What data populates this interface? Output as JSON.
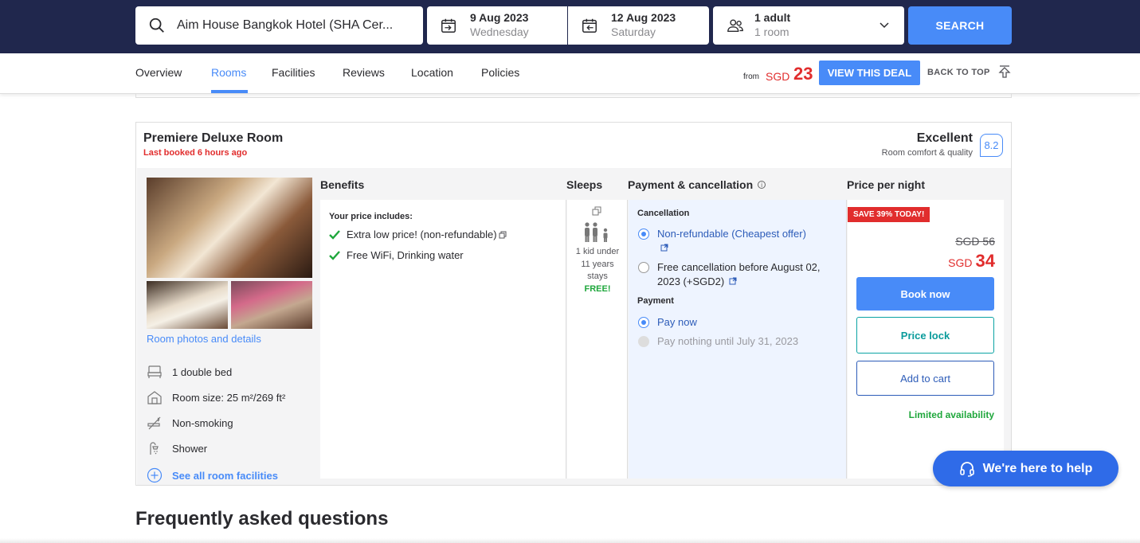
{
  "search": {
    "hotel": "Aim House Bangkok Hotel (SHA Cer...",
    "checkin_date": "9 Aug 2023",
    "checkin_day": "Wednesday",
    "checkout_date": "12 Aug 2023",
    "checkout_day": "Saturday",
    "guests": "1 adult",
    "rooms": "1 room",
    "search_label": "SEARCH"
  },
  "nav": {
    "tabs": [
      {
        "label": "Overview"
      },
      {
        "label": "Rooms"
      },
      {
        "label": "Facilities"
      },
      {
        "label": "Reviews"
      },
      {
        "label": "Location"
      },
      {
        "label": "Policies"
      }
    ],
    "active_tab": "Rooms",
    "from_label": "from",
    "from_currency": "SGD",
    "from_amount": "23",
    "deal_label": "VIEW THIS DEAL",
    "back_to_top": "BACK TO TOP"
  },
  "room": {
    "title": "Premiere Deluxe Room",
    "last_booked": "Last booked 6 hours ago",
    "rating_word": "Excellent",
    "rating_sub": "Room comfort & quality",
    "rating_score": "8.2",
    "photos_link": "Room photos and details",
    "facilities": [
      {
        "label": "1 double bed",
        "icon": "bed-icon"
      },
      {
        "label": "Room size: 25 m²/269 ft²",
        "icon": "house-icon"
      },
      {
        "label": "Non-smoking",
        "icon": "no-smoking-icon"
      },
      {
        "label": "Shower",
        "icon": "shower-icon"
      }
    ],
    "see_all": "See all room facilities"
  },
  "columns": {
    "benefits": "Benefits",
    "sleeps": "Sleeps",
    "payment": "Payment & cancellation",
    "price": "Price per night"
  },
  "benefits": {
    "heading": "Your price includes:",
    "items": [
      "Extra low price! (non-refundable)",
      "Free WiFi, Drinking water"
    ]
  },
  "sleeps": {
    "text": "1 kid under 11 years stays",
    "free": "FREE!"
  },
  "payment": {
    "cancellation_heading": "Cancellation",
    "option1": "Non-refundable (Cheapest offer)",
    "option2": "Free cancellation before August 02, 2023 (+SGD2)",
    "payment_heading": "Payment",
    "pay_now": "Pay now",
    "pay_later": "Pay nothing until July 31, 2023"
  },
  "price": {
    "badge": "SAVE 39% TODAY!",
    "old_price": "SGD 56",
    "currency": "SGD",
    "amount": "34",
    "book_now": "Book now",
    "price_lock": "Price lock",
    "add_to_cart": "Add to cart",
    "availability": "Limited availability"
  },
  "help": "We're here to help",
  "faq_title": "Frequently asked questions",
  "colors": {
    "navy": "#20274d",
    "accent": "#488bf8",
    "red": "#e12d2d",
    "green": "#1fa73c",
    "teal": "#0a9b9b"
  }
}
